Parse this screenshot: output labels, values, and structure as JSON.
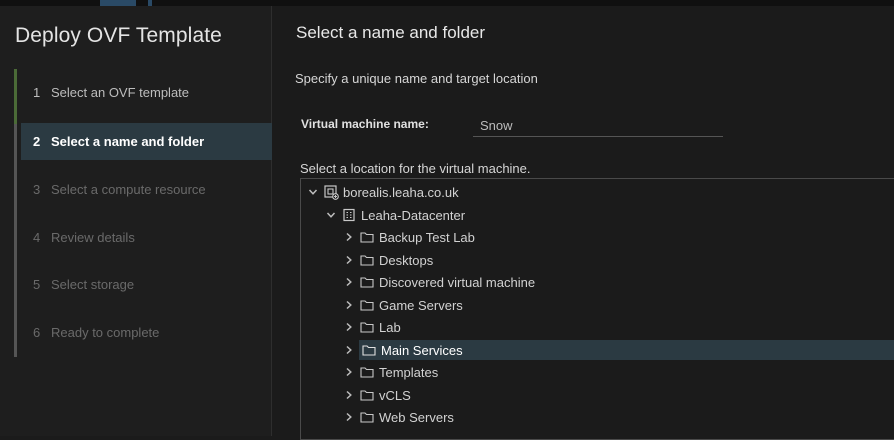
{
  "wizard": {
    "title": "Deploy OVF Template",
    "steps": [
      {
        "num": "1",
        "label": "Select an OVF template",
        "state": "done"
      },
      {
        "num": "2",
        "label": "Select a name and folder",
        "state": "active"
      },
      {
        "num": "3",
        "label": "Select a compute resource",
        "state": "pending"
      },
      {
        "num": "4",
        "label": "Review details",
        "state": "pending"
      },
      {
        "num": "5",
        "label": "Select storage",
        "state": "pending"
      },
      {
        "num": "6",
        "label": "Ready to complete",
        "state": "pending"
      }
    ]
  },
  "page": {
    "title": "Select a name and folder",
    "subtitle": "Specify a unique name and target location",
    "vm_name_label": "Virtual machine name:",
    "vm_name_value": "Snow",
    "location_label": "Select a location for the virtual machine."
  },
  "tree": {
    "root": {
      "label": "borealis.leaha.co.uk",
      "icon": "vcenter-icon",
      "expanded": true
    },
    "datacenter": {
      "label": "Leaha-Datacenter",
      "icon": "datacenter-icon",
      "expanded": true
    },
    "folders": [
      {
        "label": "Backup Test Lab",
        "selected": false
      },
      {
        "label": "Desktops",
        "selected": false
      },
      {
        "label": "Discovered virtual machine",
        "selected": false
      },
      {
        "label": "Game Servers",
        "selected": false
      },
      {
        "label": "Lab",
        "selected": false
      },
      {
        "label": "Main Services",
        "selected": true
      },
      {
        "label": "Templates",
        "selected": false
      },
      {
        "label": "vCLS",
        "selected": false
      },
      {
        "label": "Web Servers",
        "selected": false
      }
    ]
  },
  "colors": {
    "background": "#1b1b1b",
    "selection": "#2b3a42",
    "progress": "#4b6b37"
  }
}
